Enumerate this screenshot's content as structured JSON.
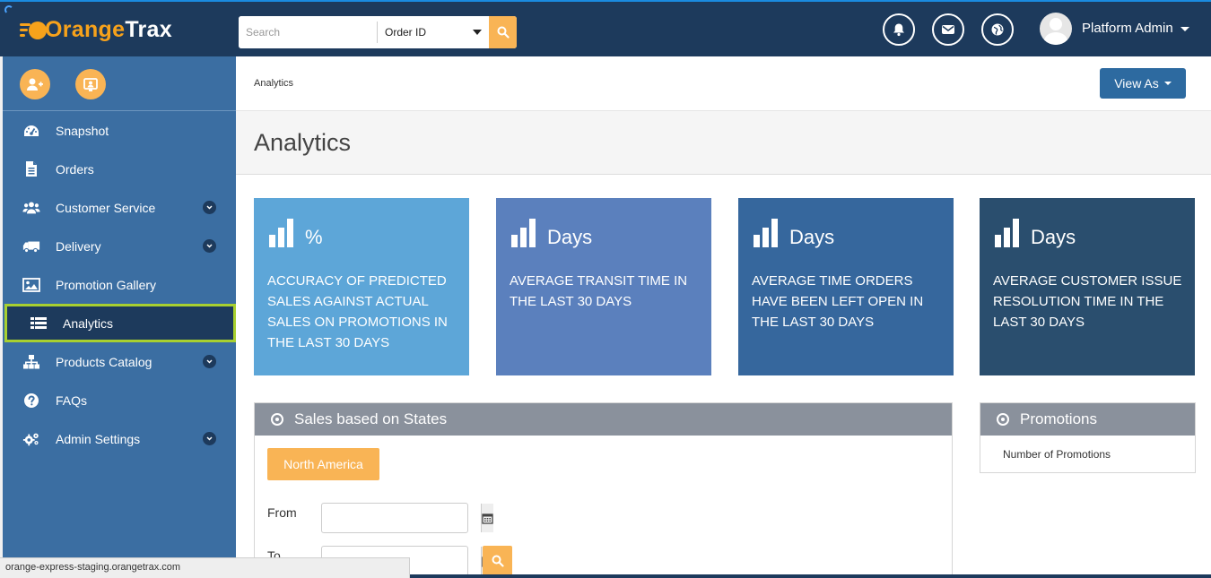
{
  "brand": {
    "name_part1": "Orange",
    "name_part2": "Trax",
    "accent": "#f7a21b",
    "header_bg": "#1d3a5c"
  },
  "search": {
    "placeholder": "Search",
    "type_selected": "Order ID"
  },
  "header_icons": [
    "bell-icon",
    "envelope-icon",
    "globe-icon"
  ],
  "user": {
    "name": "Platform Admin"
  },
  "sidebar": {
    "quick_actions": [
      "add-user-icon",
      "id-card-icon"
    ],
    "items": [
      {
        "label": "Snapshot",
        "icon": "dashboard-icon",
        "has_submenu": false
      },
      {
        "label": "Orders",
        "icon": "document-icon",
        "has_submenu": false
      },
      {
        "label": "Customer Service",
        "icon": "users-icon",
        "has_submenu": true
      },
      {
        "label": "Delivery",
        "icon": "truck-icon",
        "has_submenu": true
      },
      {
        "label": "Promotion Gallery",
        "icon": "image-icon",
        "has_submenu": false
      },
      {
        "label": "Analytics",
        "icon": "table-list-icon",
        "has_submenu": false,
        "active": true
      },
      {
        "label": "Products Catalog",
        "icon": "sitemap-icon",
        "has_submenu": true
      },
      {
        "label": "FAQs",
        "icon": "question-circle-icon",
        "has_submenu": false
      },
      {
        "label": "Admin Settings",
        "icon": "cogs-icon",
        "has_submenu": true
      }
    ]
  },
  "breadcrumb": {
    "current": "Analytics"
  },
  "view_as": {
    "label": "View As"
  },
  "page": {
    "title": "Analytics"
  },
  "kpis": [
    {
      "unit": "%",
      "description": "ACCURACY OF PREDICTED SALES AGAINST ACTUAL SALES ON PROMOTIONS IN THE LAST 30 DAYS",
      "color": "#5da6d8"
    },
    {
      "unit": "Days",
      "description": "AVERAGE TRANSIT TIME IN THE LAST 30 DAYS",
      "color": "#5b80bd"
    },
    {
      "unit": "Days",
      "description": "AVERAGE TIME ORDERS HAVE BEEN LEFT OPEN IN THE LAST 30 DAYS",
      "color": "#36679d"
    },
    {
      "unit": "Days",
      "description": "AVERAGE CUSTOMER ISSUE RESOLUTION TIME IN THE LAST 30 DAYS",
      "color": "#2a4e6e"
    }
  ],
  "sales_panel": {
    "title": "Sales based on States",
    "region_button": "North America",
    "from_label": "From",
    "to_label": "To",
    "from_value": "",
    "to_value": ""
  },
  "promotions_panel": {
    "title": "Promotions",
    "metric_label": "Number of Promotions"
  },
  "status_bar": {
    "url": "orange-express-staging.orangetrax.com"
  }
}
